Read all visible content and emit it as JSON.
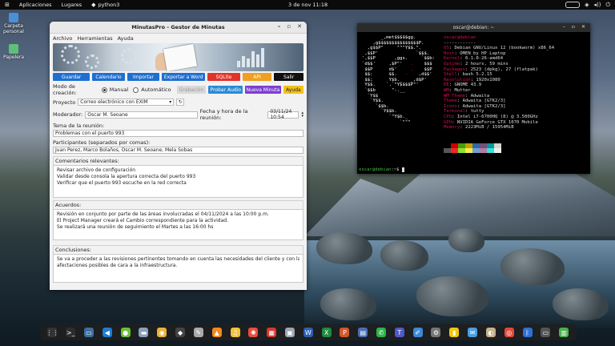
{
  "topbar": {
    "activities": "Aplicaciones",
    "places": "Lugares",
    "app": "python3",
    "clock": "3 de nov  11:18"
  },
  "desktop": {
    "icons": [
      {
        "label": "Carpeta personal",
        "color": "#4a90d9"
      },
      {
        "label": "Papelera",
        "color": "#5fbf7a"
      }
    ]
  },
  "app": {
    "title": "MinutasPro - Gestor de Minutas",
    "menu": [
      "Archivo",
      "Herramientas",
      "Ayuda"
    ],
    "buttons": [
      {
        "label": "Guardar",
        "color": "#1f6fd1"
      },
      {
        "label": "Calendario",
        "color": "#1f6fd1"
      },
      {
        "label": "Importar",
        "color": "#1f6fd1"
      },
      {
        "label": "Exportar a Word",
        "color": "#1f6fd1"
      },
      {
        "label": "SQLite",
        "color": "#e0342b"
      },
      {
        "label": "API",
        "color": "#f0a020"
      },
      {
        "label": "Salir",
        "color": "#111111"
      }
    ],
    "mode": {
      "label": "Modo de creación:",
      "manual": "Manual",
      "auto": "Automático",
      "grabacion": "Grabación",
      "probar": "Probar Audio",
      "nueva": "Nueva Minuta",
      "ayuda": "Ayuda"
    },
    "proyecto": {
      "label": "Proyecto",
      "value": "Correo electrónico con EXIM"
    },
    "moderador": {
      "label": "Moderador:",
      "value": "Oscar M. Seoane",
      "fecha_label": "Fecha y hora de la reunión:",
      "fecha_value": "03/11/24 10:54"
    },
    "tema": {
      "label": "Tema de la reunión:",
      "value": "Problemas con el puerto 993"
    },
    "participantes": {
      "label": "Participantes (separados por comas):",
      "value": "Juan Perez, Marco Bolaños, Oscar M. Seoane, Mela Sobas"
    },
    "comentarios": {
      "label": "Comentarios relevantes:",
      "lines": [
        "Revisar archivo de configuración",
        "Validar desde consola la apertura correcta del puerto 993",
        "Verificar que el puerto 993 escuche en la red correcta"
      ]
    },
    "acuerdos": {
      "label": "Acuerdos:",
      "lines": [
        "Revisión en conjunto por parte de las áreas involucradas el 04/11/2024 a las 10:00 p.m.",
        "El Project Manager creará el Cambio correspondiente para la actividad.",
        "Se realizará una reunión de seguimiento el Martes a las 16:00 hs"
      ]
    },
    "conclusiones": {
      "label": "Conclusiones:",
      "lines": [
        "Se va a proceder a las revisiones pertinentes tomando en cuenta las necesidades del cliente y con las menores",
        "afectaciones posibles de cara a la infraestructura."
      ]
    }
  },
  "terminal": {
    "title": "oscar@debian: ~",
    "header": "oscar@debian",
    "sep": "------------",
    "info": [
      {
        "k": "OS",
        "v": ": Debian GNU/Linux 12 (bookworm) x86_64"
      },
      {
        "k": "Host",
        "v": ": OMEN by HP Laptop"
      },
      {
        "k": "Kernel",
        "v": ": 6.1.0-26-amd64"
      },
      {
        "k": "Uptime",
        "v": ": 2 hours, 59 mins"
      },
      {
        "k": "Packages",
        "v": ": 2523 (dpkg), 27 (flatpak)"
      },
      {
        "k": "Shell",
        "v": ": bash 5.2.15"
      },
      {
        "k": "Resolution",
        "v": ": 1920x1080"
      },
      {
        "k": "DE",
        "v": ": GNOME 43.9"
      },
      {
        "k": "WM",
        "v": ": Mutter"
      },
      {
        "k": "WM Theme",
        "v": ": Adwaita"
      },
      {
        "k": "Theme",
        "v": ": Adwaita [GTK2/3]"
      },
      {
        "k": "Icons",
        "v": ": Adwaita [GTK2/3]"
      },
      {
        "k": "Terminal",
        "v": ": tutty"
      },
      {
        "k": "CPU",
        "v": ": Intel i7-6700HQ (8) @ 3.500GHz"
      },
      {
        "k": "GPU",
        "v": ": NVIDIA GeForce GTX 1070 Mobile"
      },
      {
        "k": "Memory",
        "v": ": 2223MiB / 15954MiB"
      }
    ],
    "prompt": "oscar@debian",
    "prompt_suffix": ":~$ ",
    "palette": [
      "#000000",
      "#cc0000",
      "#4e9a06",
      "#c4a000",
      "#3465a4",
      "#75507b",
      "#06989a",
      "#d3d7cf",
      "#555753",
      "#ef2929",
      "#8ae234",
      "#fce94f",
      "#729fcf",
      "#ad7fa8",
      "#34e2e2",
      "#eeeeec"
    ]
  },
  "dock": {
    "items": [
      {
        "name": "apps-grid-icon",
        "glyph": "⋮⋮",
        "color": "#333333"
      },
      {
        "name": "terminal-icon",
        "glyph": ">_",
        "color": "#2d2d2d"
      },
      {
        "name": "screen-icon",
        "glyph": "▭",
        "color": "#3c6e9e"
      },
      {
        "name": "vscode-icon",
        "glyph": "◀",
        "color": "#1f7cd1"
      },
      {
        "name": "keepass-icon",
        "glyph": "●",
        "color": "#6cbf3a"
      },
      {
        "name": "files-icon",
        "glyph": "▬",
        "color": "#8aa1b9"
      },
      {
        "name": "chrome-icon",
        "glyph": "◉",
        "color": "#e8b23a"
      },
      {
        "name": "inkscape-icon",
        "glyph": "◆",
        "color": "#444444"
      },
      {
        "name": "tool-icon",
        "glyph": "✎",
        "color": "#aaaaaa"
      },
      {
        "name": "vlc-icon",
        "glyph": "▲",
        "color": "#f08a1c"
      },
      {
        "name": "audio-icon",
        "glyph": "♫",
        "color": "#f2c23a"
      },
      {
        "name": "pinwheel-icon",
        "glyph": "✺",
        "color": "#ea4d3f"
      },
      {
        "name": "calendar-icon",
        "glyph": "▦",
        "color": "#d23b2f"
      },
      {
        "name": "shot-icon",
        "glyph": "▣",
        "color": "#9aa6b2"
      },
      {
        "name": "word-icon",
        "glyph": "W",
        "color": "#2b5fb4"
      },
      {
        "name": "excel-icon",
        "glyph": "X",
        "color": "#1e8c3e"
      },
      {
        "name": "ppt-icon",
        "glyph": "P",
        "color": "#d2582b"
      },
      {
        "name": "doc-icon",
        "glyph": "▤",
        "color": "#4a6fb5"
      },
      {
        "name": "whatsapp-icon",
        "glyph": "✆",
        "color": "#2db34a"
      },
      {
        "name": "teams-icon",
        "glyph": "T",
        "color": "#5059c9"
      },
      {
        "name": "paint-icon",
        "glyph": "✐",
        "color": "#3b89d8"
      },
      {
        "name": "settings-icon",
        "glyph": "⚙",
        "color": "#777777"
      },
      {
        "name": "notes-icon",
        "glyph": "▮",
        "color": "#f2c50f"
      },
      {
        "name": "chat-icon",
        "glyph": "✉",
        "color": "#4aa0e0"
      },
      {
        "name": "game-icon",
        "glyph": "◐",
        "color": "#c6b28a"
      },
      {
        "name": "lifebuoy-icon",
        "glyph": "◎",
        "color": "#e04a3f"
      },
      {
        "name": "bluetooth-icon",
        "glyph": "ᛒ",
        "color": "#2f6fd6"
      },
      {
        "name": "display-icon",
        "glyph": "▭",
        "color": "#555555"
      },
      {
        "name": "trash-icon",
        "glyph": "▥",
        "color": "#4caf50"
      }
    ]
  }
}
